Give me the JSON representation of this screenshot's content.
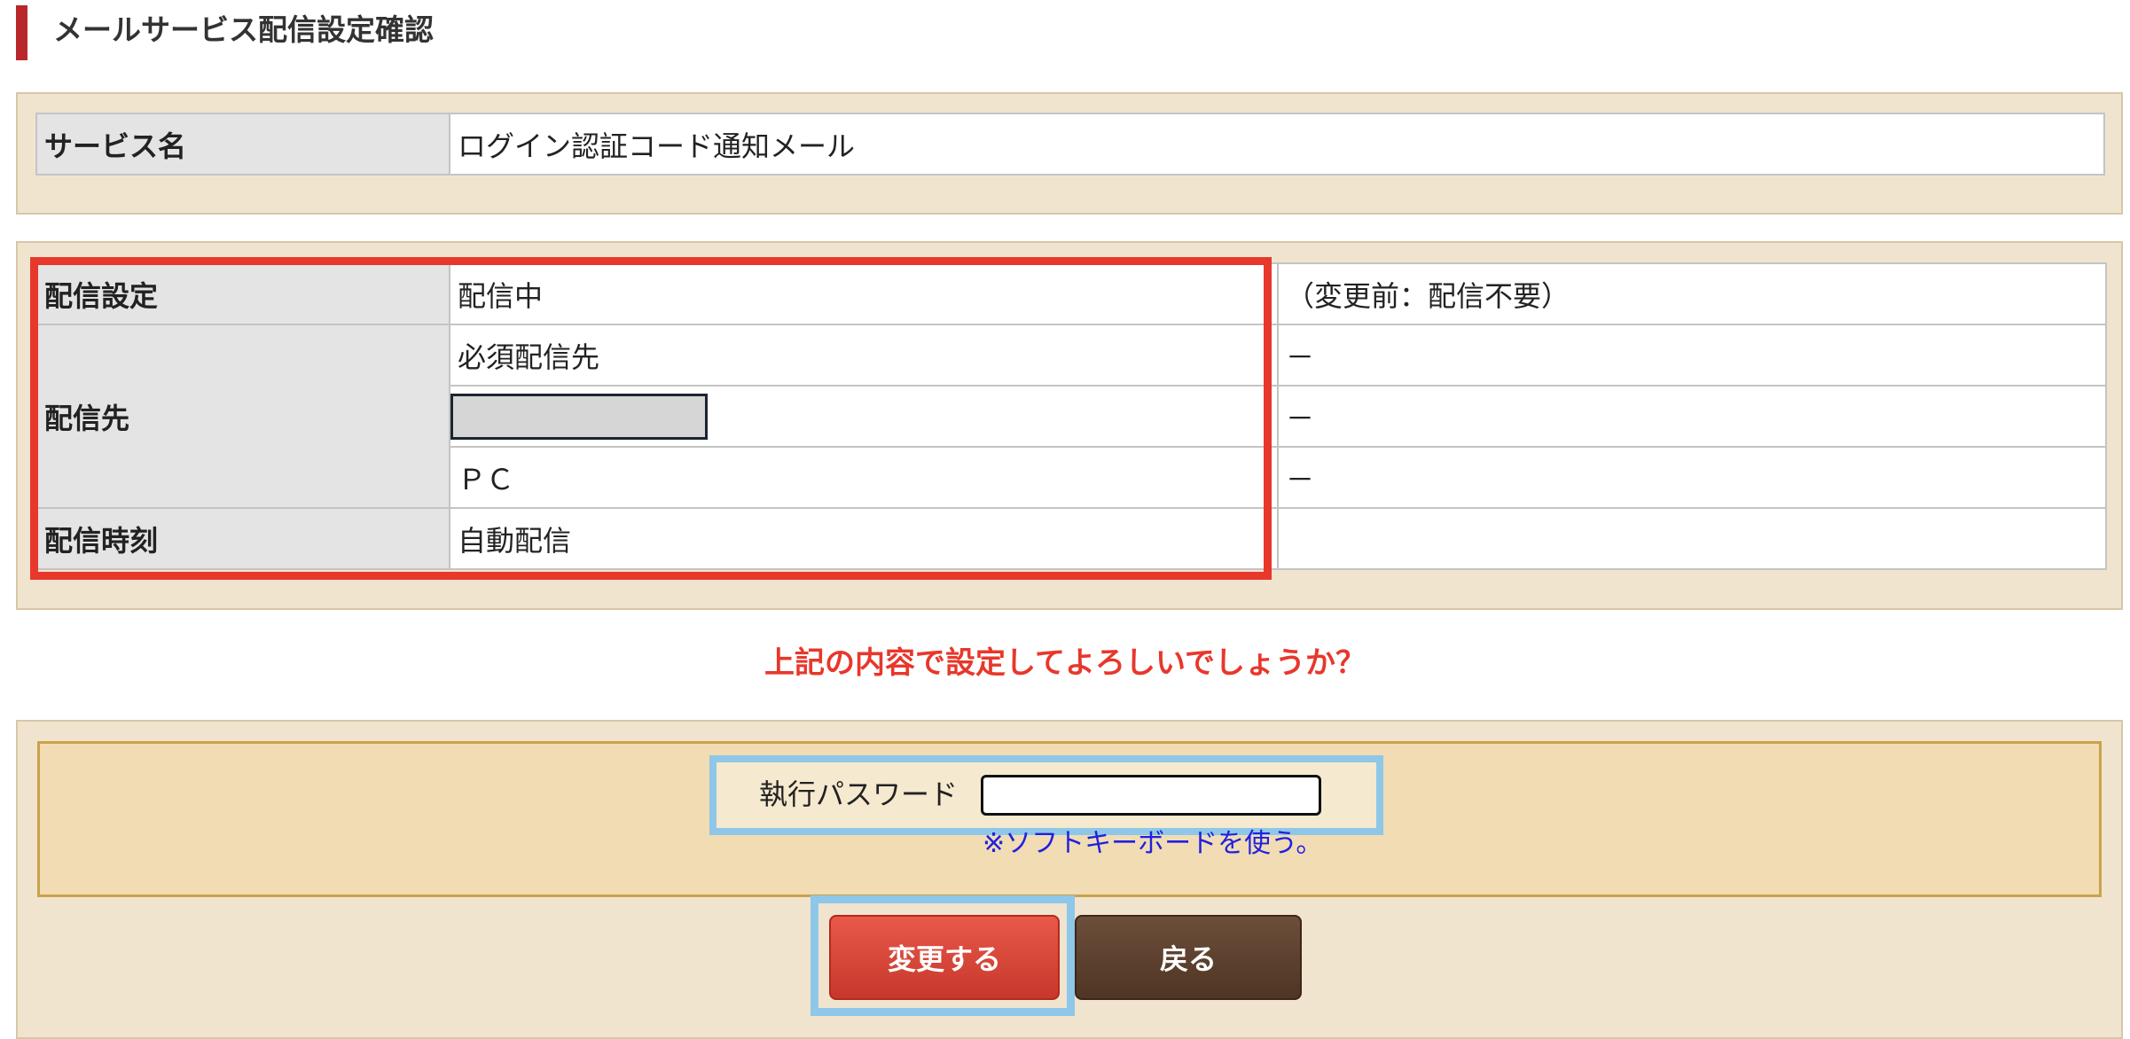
{
  "page": {
    "title": "メールサービス配信設定確認"
  },
  "service": {
    "label": "サービス名",
    "value": "ログイン認証コード通知メール"
  },
  "settings": {
    "delivery_setting_label": "配信設定",
    "delivery_setting_value": "配信中",
    "delivery_setting_before": "（変更前：配信不要）",
    "destination_label": "配信先",
    "destinations": [
      {
        "name": "必須配信先",
        "before": "－"
      },
      {
        "name": "",
        "before": "－"
      },
      {
        "name": "ＰＣ",
        "before": "－"
      }
    ],
    "time_label": "配信時刻",
    "time_value": "自動配信",
    "time_before": ""
  },
  "confirm": {
    "message": "上記の内容で設定してよろしいでしょうか？"
  },
  "password": {
    "label": "執行パスワード",
    "value": "",
    "soft_keyboard_link": "※ソフトキーボードを使う。"
  },
  "buttons": {
    "change_label": "変更する",
    "back_label": "戻る"
  },
  "colors": {
    "accent_red": "#e8372b",
    "highlight_blue": "#8ec7e8",
    "panel_beige": "#f1e4cf",
    "title_bar": "#b8282b"
  }
}
